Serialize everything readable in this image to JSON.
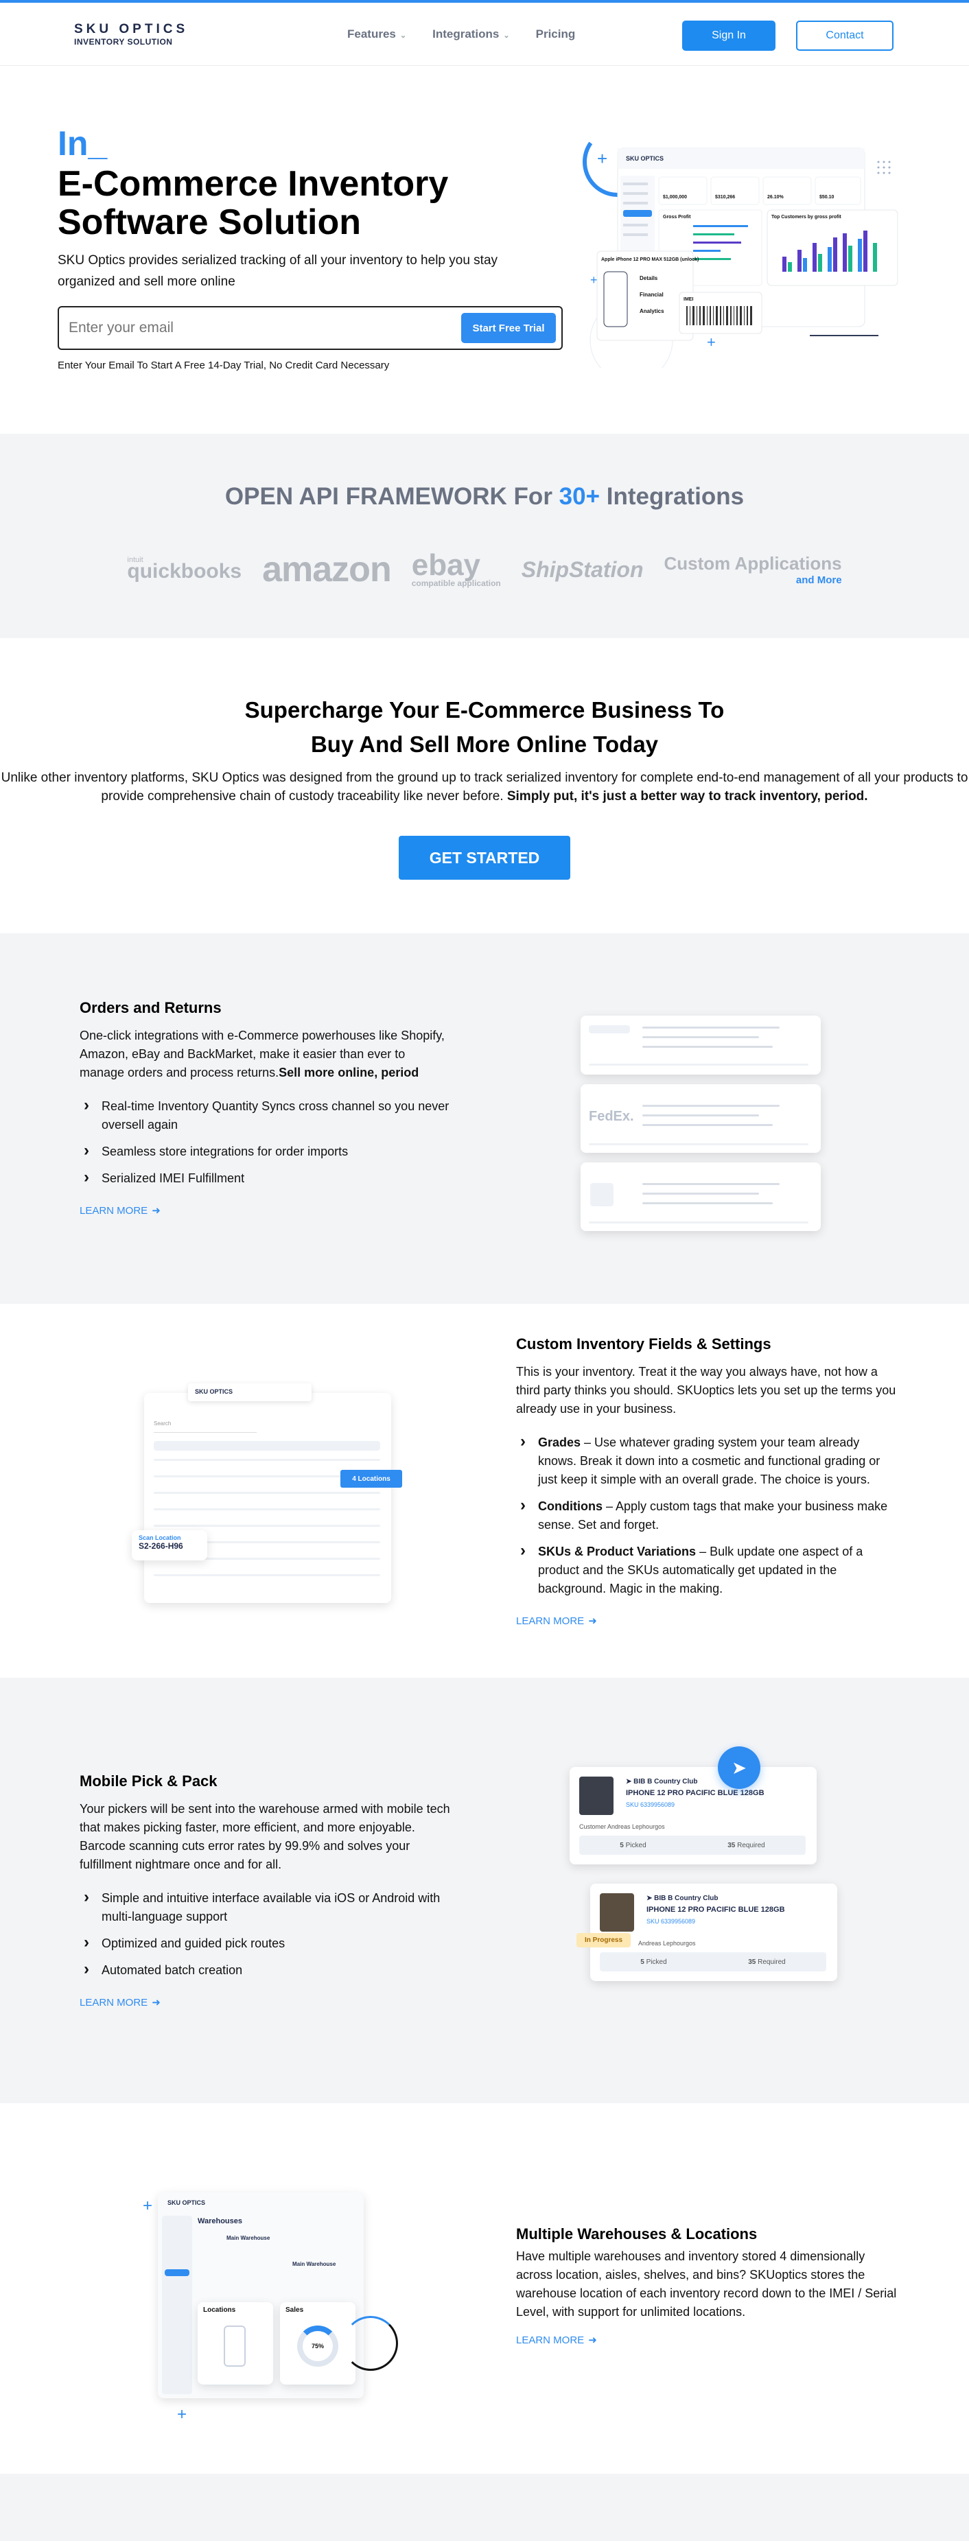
{
  "nav": {
    "logo_top": "SKU OPTICS",
    "logo_bottom": "INVENTORY SOLUTION",
    "items": [
      {
        "label": "Features",
        "has_dropdown": true
      },
      {
        "label": "Integrations",
        "has_dropdown": true
      },
      {
        "label": "Pricing",
        "has_dropdown": false
      }
    ],
    "sign_in": "Sign In",
    "contact": "Contact"
  },
  "hero": {
    "typed": "In_",
    "title": "E-Commerce Inventory Software Solution",
    "subtitle": "SKU Optics provides serialized tracking of all your inventory to help you stay organized and sell more online",
    "email_placeholder": "Enter your email",
    "cta": "Start Free Trial",
    "note": "Enter Your Email To Start A Free 14-Day Trial, No Credit Card Necessary",
    "mock": {
      "logo": "SKU OPTICS",
      "stats": [
        "$1,000,000",
        "$310,266",
        "26.10%",
        "$50.10"
      ],
      "gross_profit": "Gross Profit",
      "top_customers": "Top Customers by gross profit",
      "product": "Apple iPhone 12 PRO MAX 512GB (unlock)",
      "tabs": [
        "Details",
        "Financial",
        "Analytics"
      ],
      "imei": "IMEI"
    }
  },
  "api": {
    "title_pre": "OPEN API FRAMEWORK For ",
    "title_num": "30+",
    "title_post": " Integrations",
    "logos": {
      "qb_small": "intuit",
      "qb": "quickbooks",
      "amazon": "amazon",
      "ebay": "ebay",
      "ebay_sub": "compatible application",
      "shipstation": "ShipStation",
      "custom": "Custom Applications",
      "custom_sub": "and More"
    }
  },
  "supercharge": {
    "title_line1": "Supercharge Your E-Commerce Business To",
    "title_line2": "Buy And Sell More Online Today",
    "text_line1": "Unlike other inventory platforms, SKU Optics was designed from the ground up to track serialized inventory for complete end-to-end management of all your products to",
    "text_line2_plain": "provide comprehensive chain of custody traceability like never before. ",
    "text_line2_bold": "Simply put, it's just a better way to track inventory, period.",
    "cta": "GET STARTED"
  },
  "orders": {
    "title": "Orders and Returns",
    "desc_plain": "One-click integrations with e-Commerce powerhouses like Shopify, Amazon, eBay and BackMarket, make it easier than ever to manage orders and process returns.",
    "desc_bold": "Sell more online, period",
    "bullets": [
      "Real-time Inventory Quantity Syncs cross channel so you never oversell again",
      "Seamless store integrations for order imports",
      "Serialized IMEI Fulfillment"
    ],
    "learn_more": "LEARN MORE",
    "mock_logo": "FedEx."
  },
  "custom": {
    "title": "Custom Inventory Fields & Settings",
    "desc": "This is your inventory. Treat it the way you always have, not how a third party thinks you should. SKUoptics lets you set up the terms you already use in your business.",
    "bullets": [
      {
        "bold": "Grades",
        "text": " – Use whatever grading system your team already knows. Break it down into a cosmetic and functional grading or just keep it simple with an overall grade. The choice is yours."
      },
      {
        "bold": "Conditions",
        "text": " – Apply custom tags that make your business make sense. Set and forget."
      },
      {
        "bold": "SKUs & Product Variations",
        "text": " – Bulk update one aspect of a product and the SKUs automatically get updated in the background. Magic in the making."
      }
    ],
    "learn_more": "LEARN MORE",
    "mock": {
      "logo": "SKU OPTICS",
      "locations_tag": "4 Locations",
      "scan_label": "Scan Location",
      "scan_value": "S2-266-H96",
      "search": "Search"
    }
  },
  "mobile": {
    "title": "Mobile Pick & Pack",
    "desc": "Your pickers will be sent into the warehouse armed with mobile tech that makes picking faster, more efficient, and more enjoyable. Barcode scanning cuts error rates by 99.9% and solves your fulfillment nightmare once and for all.",
    "bullets": [
      "Simple and intuitive interface available via iOS or Android with multi-language support",
      "Optimized and guided pick routes",
      "Automated batch creation"
    ],
    "learn_more": "LEARN MORE",
    "cards": [
      {
        "store": "BIB B Country Club",
        "product": "IPHONE 12 PRO PACIFIC BLUE 128GB",
        "sku1": "SKU 6339956089",
        "customer": "Customer Andreas Lephourgos",
        "picked": "5",
        "picked_label": "Picked",
        "required": "35",
        "required_label": "Required"
      },
      {
        "store": "BIB B Country Club",
        "product": "IPHONE 12 PRO PACIFIC BLUE 128GB",
        "sku1": "SKU 6339956089",
        "customer": "Andreas Lephourgos",
        "picked": "5",
        "picked_label": "Picked",
        "required": "35",
        "required_label": "Required",
        "badge": "In Progress"
      }
    ]
  },
  "warehouses": {
    "title": "Multiple Warehouses & Locations",
    "desc": "Have multiple warehouses and inventory stored 4 dimensionally across location, aisles, shelves, and bins? SKUoptics stores the warehouse location of each inventory record down to the IMEI / Serial Level, with support for unlimited locations.",
    "learn_more": "LEARN MORE",
    "mock": {
      "logo": "SKU OPTICS",
      "warehouses_label": "Warehouses",
      "wh1": "Main Warehouse",
      "wh2": "Main Warehouse",
      "locations": "Locations",
      "sales": "Sales",
      "gauge": "75%"
    }
  },
  "colors": {
    "accent": "#2f8cf0",
    "gray_bg": "#f3f4f6",
    "muted": "#6a7282"
  }
}
